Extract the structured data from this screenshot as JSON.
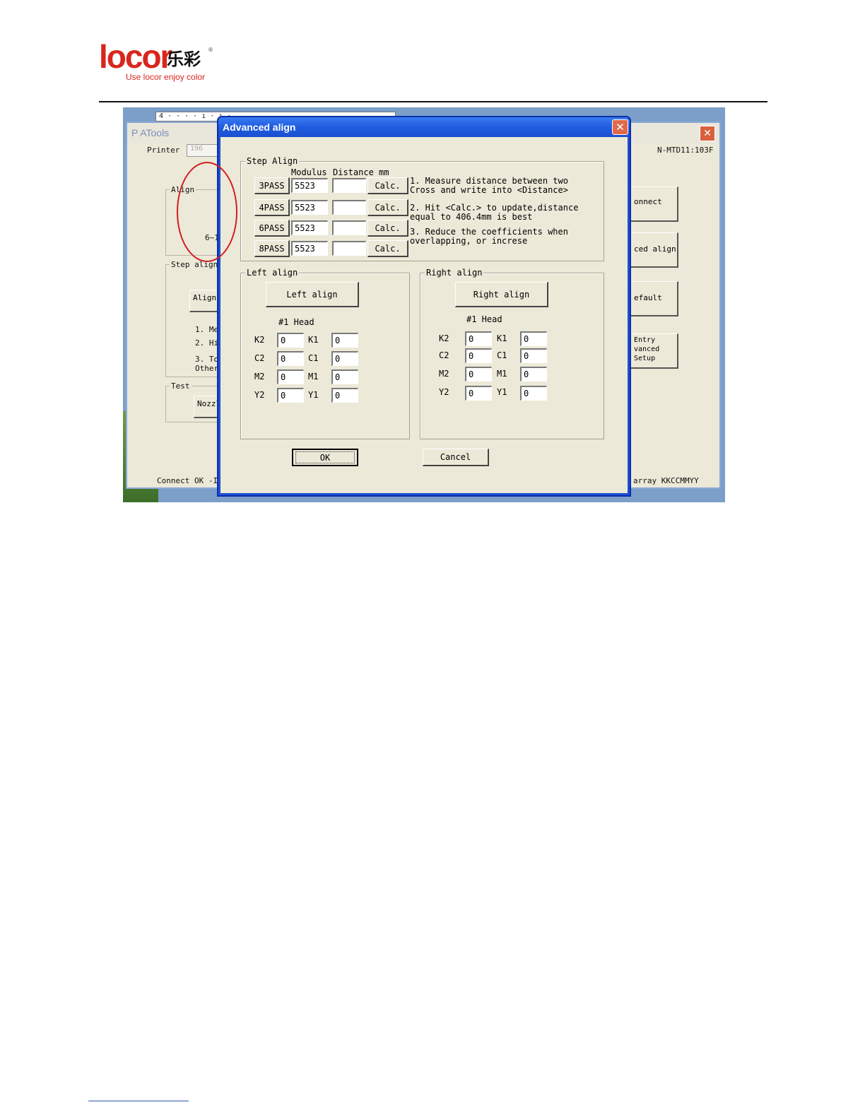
{
  "doc": {
    "logo_word": "locor",
    "logo_cn": "乐彩",
    "logo_reg": "®",
    "slogan": "Use locor  enjoy color"
  },
  "background_window": {
    "title": "P  ATools",
    "close_glyph": "✕",
    "ruler_text": "4 · · · · ı · ı ·",
    "printer_label": "Printer",
    "printer_field": "196",
    "model_text": "N-MTD11:103F",
    "align_group": "Align",
    "range_text": "6~1",
    "step_align_group": "Step align",
    "align_button": "Align",
    "step_lines": [
      "1. Me",
      "2. Hi",
      "3. To",
      "Other"
    ],
    "test_group": "Test",
    "nozzle_button": "Nozzl",
    "right_buttons": [
      "onnect",
      "ced align",
      "efault",
      "Entry\nvanced\nSetup"
    ],
    "status_left": "Connect OK  -I",
    "status_right": "array KKCCMMYY"
  },
  "dialog": {
    "title": "Advanced align",
    "close_glyph": "✕",
    "step_align": {
      "group_label": "Step Align",
      "header_modulus": "Modulus",
      "header_distance": "Distance mm",
      "rows": [
        {
          "pass": "3PASS",
          "modulus": "5523",
          "distance": "",
          "calc": "Calc."
        },
        {
          "pass": "4PASS",
          "modulus": "5523",
          "distance": "",
          "calc": "Calc."
        },
        {
          "pass": "6PASS",
          "modulus": "5523",
          "distance": "",
          "calc": "Calc."
        },
        {
          "pass": "8PASS",
          "modulus": "5523",
          "distance": "",
          "calc": "Calc."
        }
      ],
      "instructions": [
        "1. Measure distance between two\nCross and write into <Distance>",
        "2. Hit <Calc.> to update,distance\nequal to 406.4mm is best",
        "3. Reduce the coefficients when\noverlapping, or increse"
      ]
    },
    "left_align": {
      "group_label": "Left align",
      "button": "Left align",
      "head_label": "#1 Head",
      "rows": [
        {
          "l2": "K2",
          "v2": "0",
          "l1": "K1",
          "v1": "0"
        },
        {
          "l2": "C2",
          "v2": "0",
          "l1": "C1",
          "v1": "0"
        },
        {
          "l2": "M2",
          "v2": "0",
          "l1": "M1",
          "v1": "0"
        },
        {
          "l2": "Y2",
          "v2": "0",
          "l1": "Y1",
          "v1": "0"
        }
      ]
    },
    "right_align": {
      "group_label": "Right align",
      "button": "Right align",
      "head_label": "#1 Head",
      "rows": [
        {
          "l2": "K2",
          "v2": "0",
          "l1": "K1",
          "v1": "0"
        },
        {
          "l2": "C2",
          "v2": "0",
          "l1": "C1",
          "v1": "0"
        },
        {
          "l2": "M2",
          "v2": "0",
          "l1": "M1",
          "v1": "0"
        },
        {
          "l2": "Y2",
          "v2": "0",
          "l1": "Y1",
          "v1": "0"
        }
      ]
    },
    "ok_label": "OK",
    "cancel_label": "Cancel"
  },
  "colors": {
    "brand_red": "#d9261c",
    "xp_blue": "#1d50d3",
    "dialog_face": "#ece9d8",
    "highlight_circle": "#d21e1e"
  }
}
